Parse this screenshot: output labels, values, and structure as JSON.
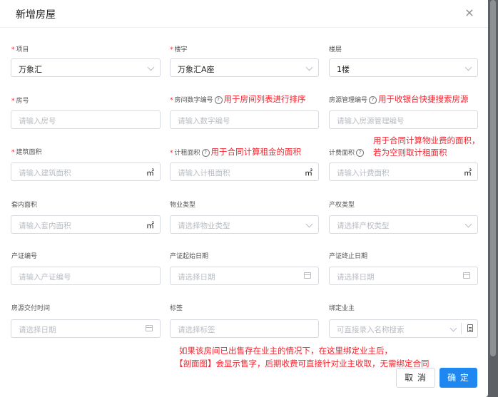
{
  "dialog": {
    "title": "新增房屋",
    "close_icon": "×"
  },
  "fields": {
    "project": {
      "label": "项目",
      "required": true,
      "value": "万象汇"
    },
    "building": {
      "label": "楼宇",
      "required": true,
      "value": "万象汇A座"
    },
    "floor": {
      "label": "楼层",
      "required": false,
      "value": "1楼"
    },
    "room_no": {
      "label": "房号",
      "required": true,
      "placeholder": "请输入房号"
    },
    "room_num_code": {
      "label": "房间数字编号",
      "required": true,
      "placeholder": "请输入数字编号",
      "note": "用于房间列表进行排序"
    },
    "source_code": {
      "label": "房源管理编号",
      "required": false,
      "placeholder": "请输入房源管理编号",
      "note": "用于收银台快捷搜索房源"
    },
    "build_area": {
      "label": "建筑面积",
      "required": true,
      "placeholder": "请输入建筑面积",
      "unit": "㎡"
    },
    "rent_area": {
      "label": "计租面积",
      "required": true,
      "placeholder": "请输入计租面积",
      "unit": "㎡",
      "note": "用于合同计算租金的面积"
    },
    "fee_area": {
      "label": "计费面积",
      "required": false,
      "placeholder": "请输入计费面积",
      "unit": "㎡",
      "note_line1": "用于合同计算物业费的面积，",
      "note_line2": "若为空则取计租面积"
    },
    "inner_area": {
      "label": "套内面积",
      "required": false,
      "placeholder": "请输入套内面积",
      "unit": "㎡"
    },
    "property_type": {
      "label": "物业类型",
      "required": false,
      "placeholder": "请选择物业类型"
    },
    "ownership_type": {
      "label": "产权类型",
      "required": false,
      "placeholder": "请选择产权类型"
    },
    "cert_no": {
      "label": "产证编号",
      "required": false,
      "placeholder": "请输入产证编号"
    },
    "cert_start": {
      "label": "产证起始日期",
      "required": false,
      "placeholder": "请选择日期"
    },
    "cert_end": {
      "label": "产证终止日期",
      "required": false,
      "placeholder": "请选择日期"
    },
    "delivery_time": {
      "label": "房源交付时间",
      "required": false,
      "placeholder": "请选择日期"
    },
    "tags": {
      "label": "标签",
      "required": false,
      "placeholder": "请选择标签"
    },
    "owner": {
      "label": "绑定业主",
      "required": false,
      "placeholder": "可直接录入名称搜索"
    }
  },
  "bottom_note": {
    "line1": "如果该房间已出售存在业主的情况下，在这里绑定业主后，",
    "line2": "【剖面图】会显示售字，后期收费可直接针对业主收取，无需绑定合同"
  },
  "buttons": {
    "cancel": "取 消",
    "ok": "确 定"
  },
  "required_mark": "*",
  "help_mark": "?",
  "colors": {
    "primary": "#1e88f0",
    "required": "#f5222d",
    "note": "#f5222d"
  }
}
